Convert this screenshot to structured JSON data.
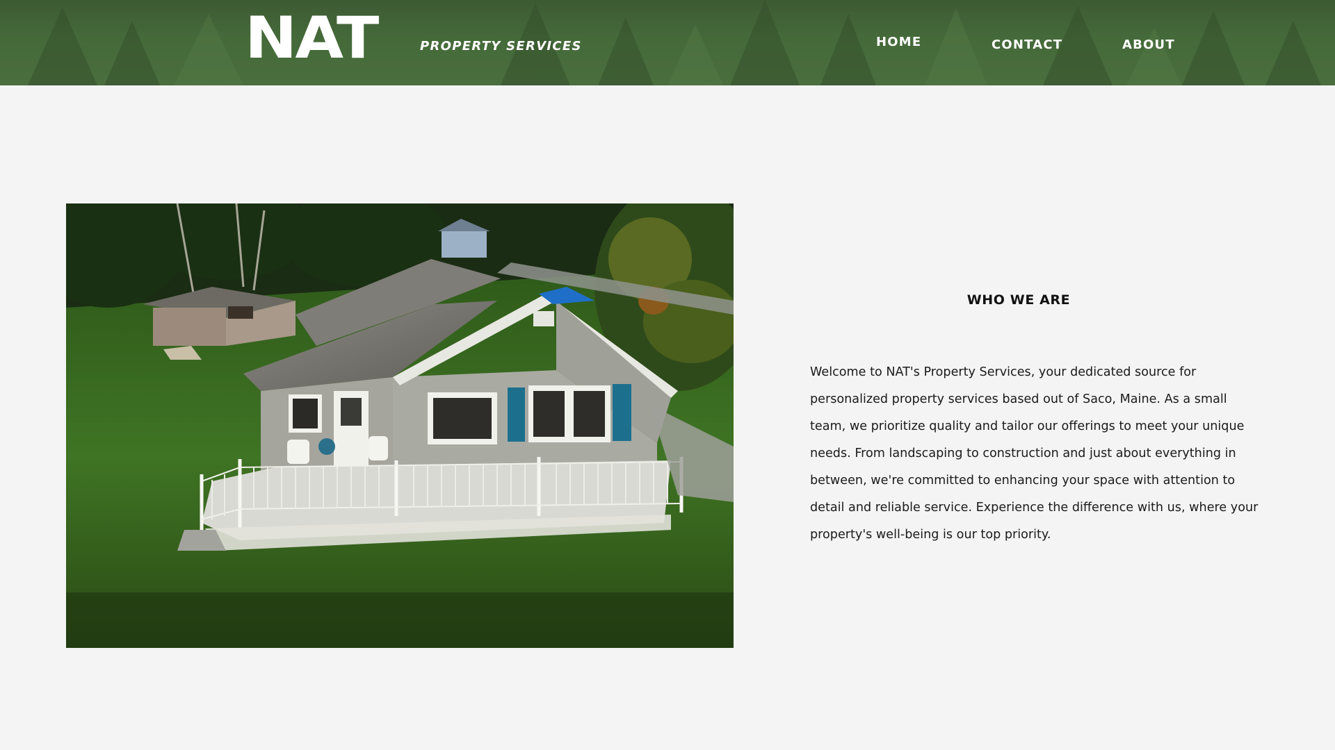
{
  "brand": {
    "logo_text": "NAT",
    "tagline": "PROPERTY SERVICES"
  },
  "nav": {
    "home": "HOME",
    "contact": "CONTACT",
    "about": "ABOUT"
  },
  "about": {
    "title": "WHO WE ARE",
    "body": "Welcome to NAT's Property Services, your dedicated source for personalized property services based out of Saco, Maine. As a small team, we prioritize quality and tailor our offerings to meet your unique needs. From landscaping to construction and just about everything in between, we're committed to enhancing your space with attention to detail and reliable service. Experience the difference with us, where your property's well-being is our top priority."
  },
  "colors": {
    "header_green": "#456a3a",
    "page_bg": "#f4f4f4",
    "text": "#1a1a1a",
    "shutter_blue": "#1d6f8e"
  }
}
